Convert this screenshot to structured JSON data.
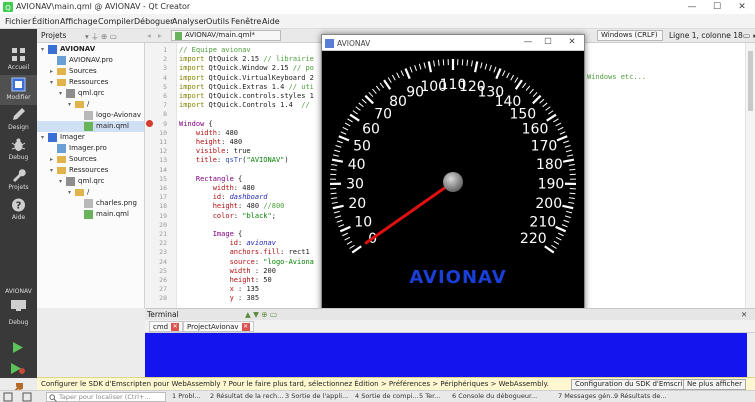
{
  "window": {
    "title": "AVIONAV\\main.qml @ AVIONAV - Qt Creator"
  },
  "menu": [
    "Fichier",
    "Édition",
    "Affichage",
    "Compiler",
    "Déboguer",
    "Analyser",
    "Outils",
    "Fenêtre",
    "Aide"
  ],
  "modes": [
    {
      "label": "Accueil",
      "icon": "grid-icon"
    },
    {
      "label": "Modifier",
      "icon": "edit-icon"
    },
    {
      "label": "Design",
      "icon": "pencil-icon"
    },
    {
      "label": "Debug",
      "icon": "bug-icon"
    },
    {
      "label": "Projets",
      "icon": "wrench-icon"
    },
    {
      "label": "Aide",
      "icon": "help-icon"
    }
  ],
  "target": {
    "project": "AVIONAV",
    "config": "Debug"
  },
  "toolbar": {
    "projects_label": "Projets",
    "file_tab": "AVIONAV/main.qml*",
    "line_ending": "Windows (CRLF)",
    "position": "Ligne 1, colonne 18"
  },
  "tree": [
    {
      "label": "AVIONAV",
      "indent": 0,
      "arrow": "▾",
      "bold": true,
      "type": "project"
    },
    {
      "label": "AVIONAV.pro",
      "indent": 1,
      "arrow": "",
      "type": "pro"
    },
    {
      "label": "Sources",
      "indent": 1,
      "arrow": "▸",
      "type": "folder"
    },
    {
      "label": "Ressources",
      "indent": 1,
      "arrow": "▾",
      "type": "folder"
    },
    {
      "label": "qml.qrc",
      "indent": 2,
      "arrow": "▾",
      "type": "qrc"
    },
    {
      "label": "/",
      "indent": 3,
      "arrow": "▾",
      "type": "folder"
    },
    {
      "label": "logo-Avionav",
      "indent": 4,
      "arrow": "",
      "type": "file"
    },
    {
      "label": "main.qml",
      "indent": 4,
      "arrow": "",
      "type": "qml",
      "selected": true
    },
    {
      "label": "Imager",
      "indent": 0,
      "arrow": "▾",
      "bold": false,
      "type": "project"
    },
    {
      "label": "Imager.pro",
      "indent": 1,
      "arrow": "",
      "type": "pro"
    },
    {
      "label": "Sources",
      "indent": 1,
      "arrow": "▸",
      "type": "folder"
    },
    {
      "label": "Ressources",
      "indent": 1,
      "arrow": "▾",
      "type": "folder"
    },
    {
      "label": "qml.qrc",
      "indent": 2,
      "arrow": "▾",
      "type": "qrc"
    },
    {
      "label": "/",
      "indent": 3,
      "arrow": "▾",
      "type": "folder"
    },
    {
      "label": "charles.png",
      "indent": 4,
      "arrow": "",
      "type": "file"
    },
    {
      "label": "main.qml",
      "indent": 4,
      "arrow": "",
      "type": "qml"
    }
  ],
  "code_lines": [
    [
      {
        "t": "// Equipe avionav",
        "c": "cm"
      }
    ],
    [
      {
        "t": "import ",
        "c": "kw"
      },
      {
        "t": "QtQuick 2.15 ",
        "c": "tx"
      },
      {
        "t": "// librairie",
        "c": "cm"
      }
    ],
    [
      {
        "t": "import ",
        "c": "kw"
      },
      {
        "t": "QtQuick.Window 2.15 ",
        "c": "tx"
      },
      {
        "t": "// po",
        "c": "cm"
      }
    ],
    [
      {
        "t": "import ",
        "c": "kw"
      },
      {
        "t": "QtQuick.VirtualKeyboard 2",
        "c": "tx"
      }
    ],
    [
      {
        "t": "import ",
        "c": "kw"
      },
      {
        "t": "QtQuick.Extras 1.4 ",
        "c": "tx"
      },
      {
        "t": "// uti",
        "c": "cm"
      }
    ],
    [
      {
        "t": "import ",
        "c": "kw"
      },
      {
        "t": "QtQuick.controls.styles 1",
        "c": "tx"
      }
    ],
    [
      {
        "t": "import ",
        "c": "kw"
      },
      {
        "t": "QtQuick.Controls 1.4  ",
        "c": "tx"
      },
      {
        "t": "//",
        "c": "cm"
      }
    ],
    [],
    [
      {
        "t": "Window ",
        "c": "ty"
      },
      {
        "t": "{",
        "c": "tx"
      }
    ],
    [
      {
        "t": "    width",
        "c": "pr"
      },
      {
        "t": ": 480",
        "c": "tx"
      }
    ],
    [
      {
        "t": "    height",
        "c": "pr"
      },
      {
        "t": ": 480",
        "c": "tx"
      }
    ],
    [
      {
        "t": "    visible",
        "c": "pr"
      },
      {
        "t": ": true",
        "c": "tx"
      }
    ],
    [
      {
        "t": "    title",
        "c": "pr"
      },
      {
        "t": ": ",
        "c": "tx"
      },
      {
        "t": "qsTr",
        "c": "fn"
      },
      {
        "t": "(",
        "c": "tx"
      },
      {
        "t": "\"AVIONAV\"",
        "c": "st"
      },
      {
        "t": ")",
        "c": "tx"
      }
    ],
    [],
    [
      {
        "t": "    Rectangle ",
        "c": "ty"
      },
      {
        "t": "{",
        "c": "tx"
      }
    ],
    [
      {
        "t": "        width",
        "c": "pr"
      },
      {
        "t": ": 480",
        "c": "tx"
      }
    ],
    [
      {
        "t": "        id",
        "c": "pr"
      },
      {
        "t": ": ",
        "c": "tx"
      },
      {
        "t": "dashboard",
        "c": "it"
      }
    ],
    [
      {
        "t": "        height",
        "c": "pr"
      },
      {
        "t": ": 480 ",
        "c": "tx"
      },
      {
        "t": "//800",
        "c": "cm"
      }
    ],
    [
      {
        "t": "        color",
        "c": "pr"
      },
      {
        "t": ": ",
        "c": "tx"
      },
      {
        "t": "\"black\"",
        "c": "st"
      },
      {
        "t": ";",
        "c": "tx"
      }
    ],
    [],
    [
      {
        "t": "        Image ",
        "c": "ty"
      },
      {
        "t": "{",
        "c": "tx"
      }
    ],
    [
      {
        "t": "            id",
        "c": "pr"
      },
      {
        "t": ": ",
        "c": "tx"
      },
      {
        "t": "avionav",
        "c": "it"
      }
    ],
    [
      {
        "t": "            anchors.fill",
        "c": "pr"
      },
      {
        "t": ": rect1",
        "c": "tx"
      }
    ],
    [
      {
        "t": "            source",
        "c": "pr"
      },
      {
        "t": ": ",
        "c": "tx"
      },
      {
        "t": "\"logo-Aviona",
        "c": "st"
      }
    ],
    [
      {
        "t": "            width ",
        "c": "pr"
      },
      {
        "t": ": 200",
        "c": "tx"
      }
    ],
    [
      {
        "t": "            height",
        "c": "pr"
      },
      {
        "t": ": 50",
        "c": "tx"
      }
    ],
    [
      {
        "t": "            x ",
        "c": "pr"
      },
      {
        "t": ": 135",
        "c": "tx"
      }
    ],
    [
      {
        "t": "            y ",
        "c": "pr"
      },
      {
        "t": ": 385",
        "c": "tx"
      }
    ]
  ],
  "code_overflow_text": "Windows etc...",
  "avionav": {
    "title": "AVIONAV",
    "gauge_labels": [
      "0",
      "10",
      "20",
      "30",
      "40",
      "50",
      "60",
      "70",
      "80",
      "90",
      "100",
      "110",
      "120",
      "130",
      "140",
      "150",
      "160",
      "170",
      "180",
      "190",
      "200",
      "210",
      "220"
    ],
    "value": 0,
    "min": 0,
    "max": 220,
    "logo": "AVIONAV",
    "needle_color": "#e01010",
    "logo_color": "#1a3fd8"
  },
  "terminal": {
    "header": "Terminal",
    "tabs": [
      {
        "label": "cmd"
      },
      {
        "label": "ProjectAvionav"
      }
    ],
    "bg_color": "#1414ee"
  },
  "notification": {
    "message": "Configurer le SDK d'Emscripten pour WebAssembly ? Pour le faire plus tard, sélectionnez Édition > Préférences > Périphériques > WebAssembly.",
    "config_button": "Configuration du SDK d'Emscripten",
    "dismiss_button": "Ne plus afficher"
  },
  "statusbar": {
    "locate_placeholder": "Taper pour localiser (Ctrl+...",
    "panes": [
      "1 Probl...",
      "2 Résultat de la rech...",
      "3 Sortie de l'appli...",
      "4 Sortie de compi...",
      "5 Ter...",
      "6 Console du débogueur...",
      "7 Messages gén...",
      "9 Résultats de..."
    ]
  }
}
